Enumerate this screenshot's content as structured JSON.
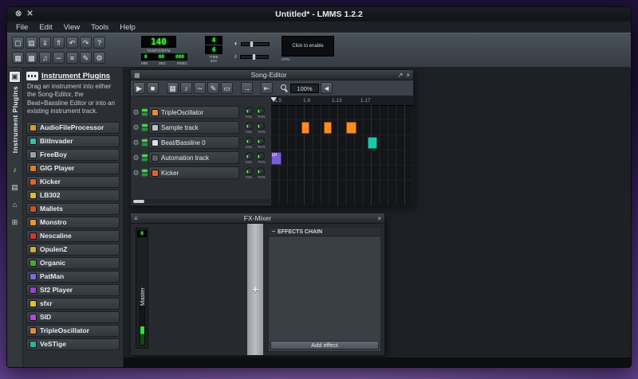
{
  "window": {
    "title": "Untitled* - LMMS 1.2.2"
  },
  "icons": {
    "minimize": "⊗",
    "close": "✕",
    "maximize_small": "↗",
    "close_small": "×",
    "grip": "▦",
    "mixer_grip": "≡",
    "gear": "⚙",
    "play": "▶",
    "stop": "■",
    "add_bb": "▦",
    "add_sample": "♪",
    "add_automation": "∼",
    "draw_mode": "✎",
    "edit_mode": "▭",
    "arrow_next": "→",
    "skip_start": "⇤",
    "zoom_arrow": "◄",
    "plus": "+",
    "chain_dash": "−",
    "tab_active": "▣",
    "tab_samples": "♪",
    "tab_presets": "▤",
    "tab_home": "⌂",
    "tab_computer": "⊞",
    "volume": "◖",
    "pitch": "♪",
    "new_project": "▢",
    "open_project": "▤",
    "save_project": "⇓",
    "export_project": "⇑",
    "undo": "↶",
    "redo": "↷",
    "help": "?",
    "song_toggle": "▦",
    "bb_toggle": "▩",
    "piano_toggle": "♫",
    "automation_toggle": "∼",
    "fx_toggle": "≡",
    "notes_toggle": "✎",
    "controller_toggle": "⚙"
  },
  "menubar": {
    "items": [
      "File",
      "Edit",
      "View",
      "Tools",
      "Help"
    ]
  },
  "toolbar": {
    "tempo": {
      "value": "140",
      "label": "TEMPO/BPM"
    },
    "time": {
      "min": "0",
      "sec": "00",
      "msec": "000",
      "labels": [
        "MIN",
        "SEC",
        "MSEC"
      ]
    },
    "timesig": {
      "numerator": "4",
      "denominator": "4",
      "label": "TIME SIG"
    },
    "cpu": {
      "label": "CPU",
      "overlay": "Click to enable"
    }
  },
  "sidebar": {
    "tab_label": "Instrument Plugins",
    "title": "Instrument Plugins",
    "description": "Drag an instrument into either the Song-Editor, the Beat+Bassline Editor or into an existing instrument track.",
    "instruments": [
      {
        "name": "AudioFileProcessor",
        "color": "#d89b2a"
      },
      {
        "name": "BitInvader",
        "color": "#35c0a8"
      },
      {
        "name": "FreeBoy",
        "color": "#9aa0a6"
      },
      {
        "name": "GIG Player",
        "color": "#e07f25"
      },
      {
        "name": "Kicker",
        "color": "#e06428"
      },
      {
        "name": "LB302",
        "color": "#d9c11e"
      },
      {
        "name": "Mallets",
        "color": "#c8542a"
      },
      {
        "name": "Monstro",
        "color": "#e09a28"
      },
      {
        "name": "Nescaline",
        "color": "#d23434"
      },
      {
        "name": "OpulenZ",
        "color": "#d8aa30"
      },
      {
        "name": "Organic",
        "color": "#4aa832"
      },
      {
        "name": "PatMan",
        "color": "#7f6ad0"
      },
      {
        "name": "Sf2 Player",
        "color": "#9a46c8"
      },
      {
        "name": "sfxr",
        "color": "#e0c424"
      },
      {
        "name": "SID",
        "color": "#b44ad2"
      },
      {
        "name": "TripleOscillator",
        "color": "#e5893a"
      },
      {
        "name": "VeSTige",
        "color": "#2fb4a0"
      }
    ]
  },
  "song_editor": {
    "title": "Song-Editor",
    "zoom": "100%",
    "timeline_labels": [
      "1.5",
      "1.9",
      "1.13",
      "1.17"
    ],
    "vol_label": "VOL",
    "pan_label": "PAN",
    "tracks": [
      {
        "name": "TripleOscillator",
        "color": "#e5893a"
      },
      {
        "name": "Sample track",
        "color": "#b9bfc5"
      },
      {
        "name": "Beat/Bassline 0",
        "color": "#dde1e4"
      },
      {
        "name": "Automation track",
        "color": "#595f66"
      },
      {
        "name": "Kicker",
        "color": "#e06428"
      }
    ],
    "patterns": {
      "sample_color": "#ff8c1f",
      "bb_color": "#1fc8a8",
      "automation_color": "#7b5ed6",
      "automation_label": "Dr"
    }
  },
  "fx_mixer": {
    "title": "FX-Mixer",
    "channel_label": "Master",
    "channel_display": "0",
    "effects_header": "EFFECTS CHAIN",
    "add_effect_label": "Add effect"
  }
}
